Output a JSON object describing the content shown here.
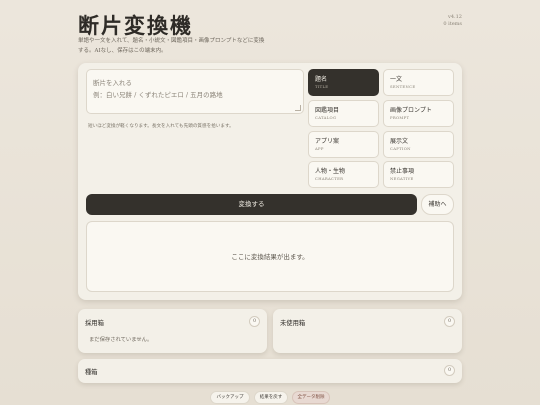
{
  "header": {
    "title": "断片変換機",
    "description": "単語や一文を入れて、題名・小説文・図鑑項目・画像プロンプトなどに変換する。AIなし、保存はこの端末内。",
    "version_line1": "v4.12",
    "version_line2": "0 items"
  },
  "input": {
    "placeholder_line1": "断片を入れる",
    "placeholder_line2": "例：白い兄餅 / くずれたピエロ / 五月の路地",
    "hint": "短いほど変換が軽くなります。長文を入れても先頭の質感を拾います。"
  },
  "modes": [
    {
      "jp": "題名",
      "en": "TITLE"
    },
    {
      "jp": "一文",
      "en": "SENTENCE"
    },
    {
      "jp": "図鑑項目",
      "en": "CATALOG"
    },
    {
      "jp": "画像プロンプト",
      "en": "PROMPT"
    },
    {
      "jp": "アプリ案",
      "en": "APP"
    },
    {
      "jp": "展示文",
      "en": "CAPTION"
    },
    {
      "jp": "人物・生物",
      "en": "CHARACTER"
    },
    {
      "jp": "禁止事項",
      "en": "NEGATIVE"
    }
  ],
  "actions": {
    "convert_label": "変換する",
    "aux_label": "補助へ"
  },
  "result": {
    "placeholder": "ここに変換結果が出ます。"
  },
  "adopted": {
    "title": "採用箱",
    "count": "0",
    "empty": "まだ保存されていません。"
  },
  "unused": {
    "title": "未使用箱",
    "count": "0"
  },
  "seed": {
    "title": "種箱",
    "count": "0"
  },
  "footer": {
    "backup": "バックアップ",
    "restore": "結果を戻す",
    "delete_all": "全データ削除"
  }
}
